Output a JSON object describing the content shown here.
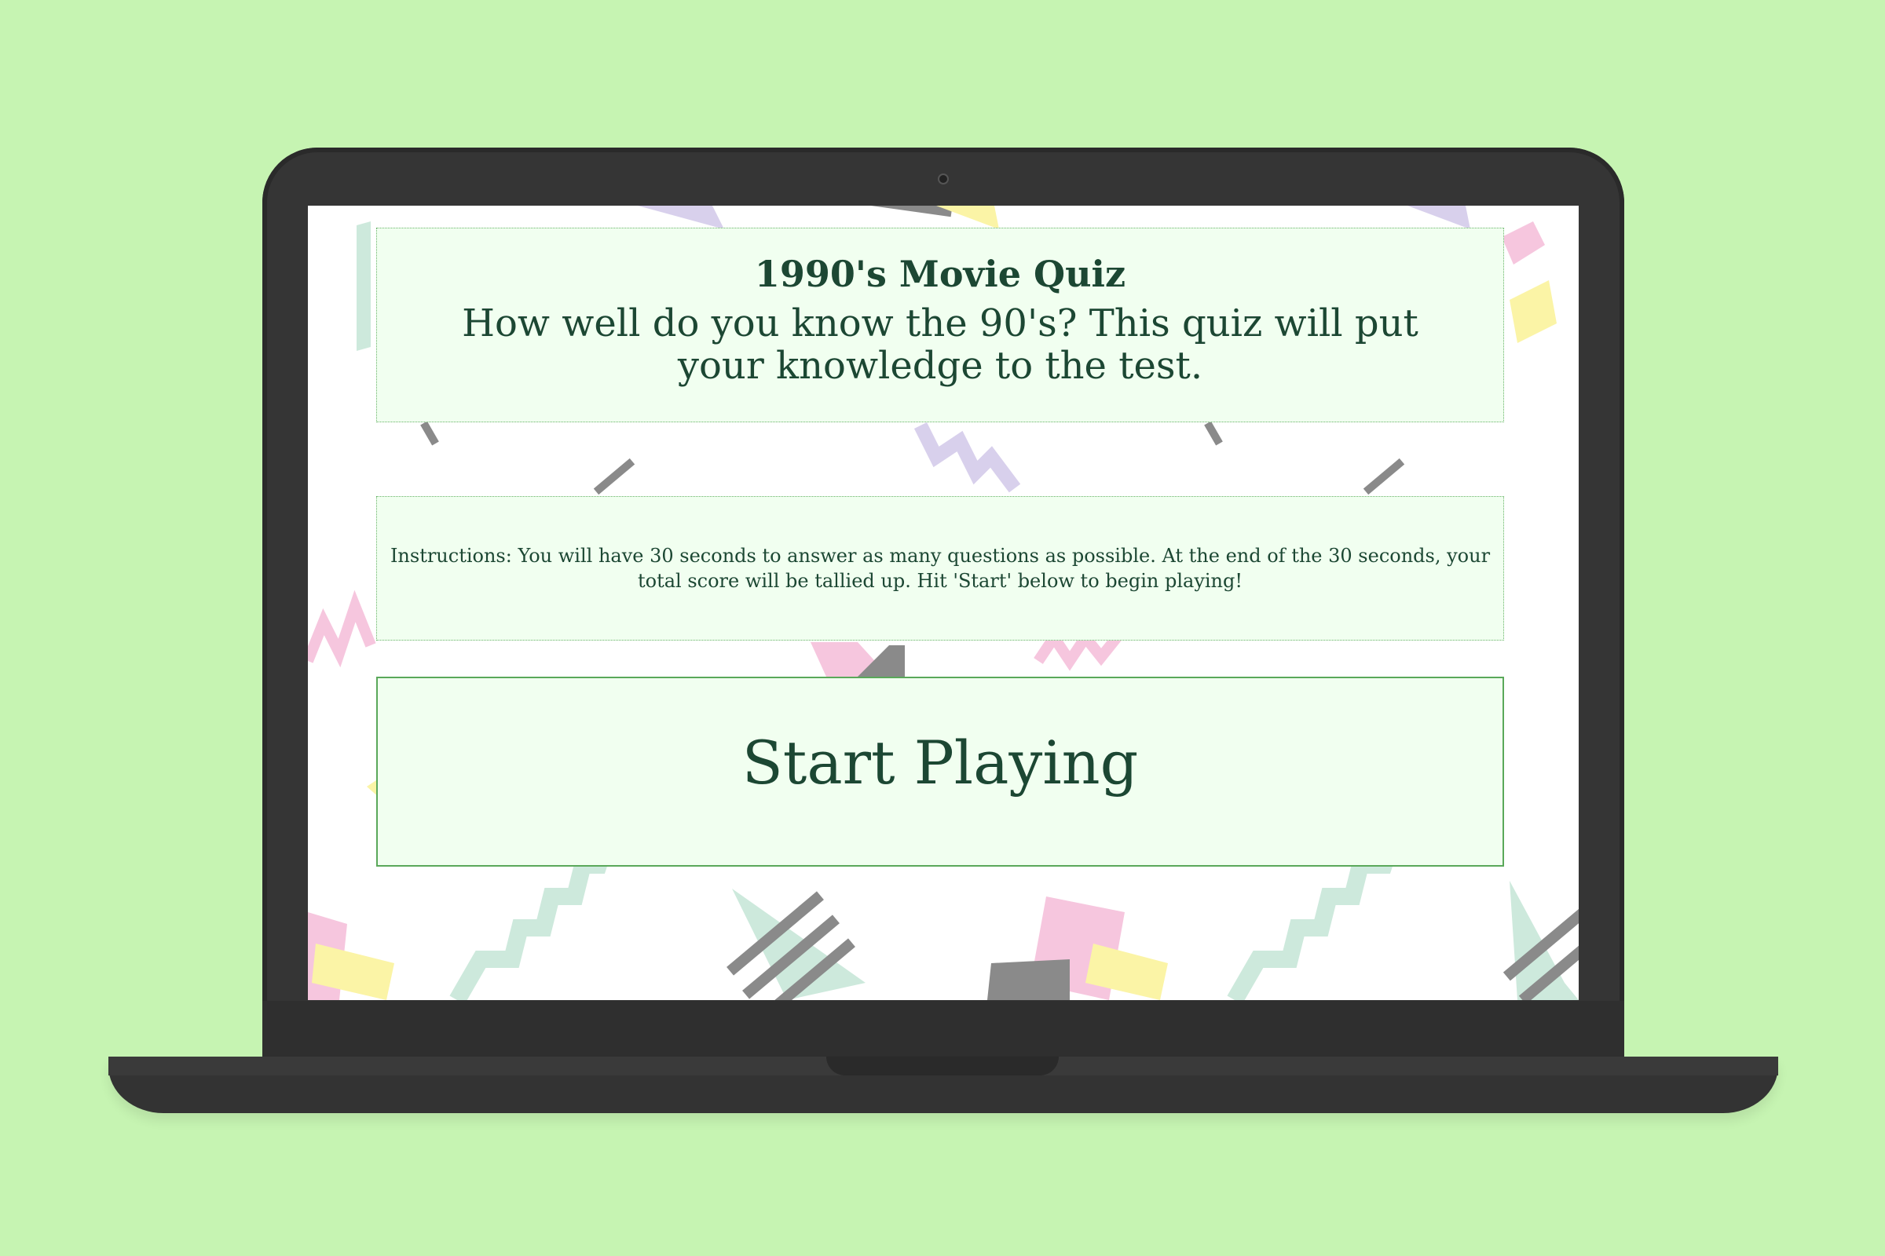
{
  "header": {
    "title": "1990's Movie Quiz",
    "subtitle": "How well do you know the 90's? This quiz will put your knowledge to the test."
  },
  "instructions": {
    "text": "Instructions: You will have 30 seconds to answer as many questions as possible. At the end of the 30 seconds, your total score will be tallied up. Hit 'Start' below to begin playing!"
  },
  "start_button": {
    "label": "Start Playing"
  },
  "colors": {
    "page_background": "#c6f4b2",
    "panel_background": "#f1fff0",
    "text": "#1c4733",
    "border": "#5aa85a",
    "laptop_body": "#353535",
    "pattern_pink": "#f6c6de",
    "pattern_purple": "#d8d0ec",
    "pattern_yellow": "#fbf4a6",
    "pattern_mint": "#cde9dc",
    "pattern_gray": "#8a8a8a"
  }
}
